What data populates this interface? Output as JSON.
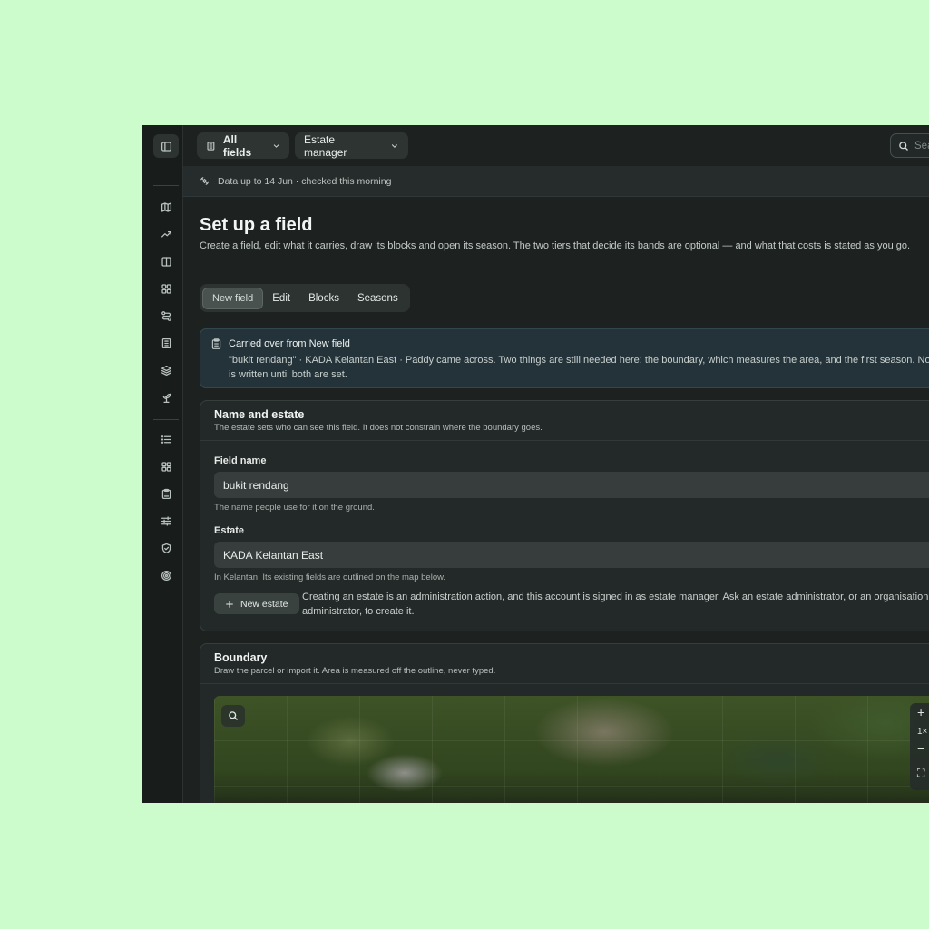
{
  "topbar": {
    "fields_filter": "All fields",
    "role": "Estate manager",
    "search_placeholder": "Search..."
  },
  "status": {
    "text": "Data up to 14 Jun · checked this morning"
  },
  "page": {
    "title": "Set up a field",
    "description": "Create a field, edit what it carries, draw its blocks and open its season. The two tiers that decide its bands are optional — and what that costs is stated as you go."
  },
  "tabs": [
    {
      "label": "New field",
      "active": true
    },
    {
      "label": "Edit",
      "active": false
    },
    {
      "label": "Blocks",
      "active": false
    },
    {
      "label": "Seasons",
      "active": false
    }
  ],
  "notice": {
    "title": "Carried over from New field",
    "body": "\"bukit rendang\" · KADA Kelantan East · Paddy came across. Two things are still needed here: the boundary, which measures the area, and the first season. Nothing is written until both are set."
  },
  "name_card": {
    "title": "Name and estate",
    "subtitle": "The estate sets who can see this field. It does not constrain where the boundary goes.",
    "field_name_label": "Field name",
    "field_name_value": "bukit rendang",
    "field_name_help": "The name people use for it on the ground.",
    "estate_label": "Estate",
    "estate_value": "KADA Kelantan East",
    "estate_help": "In Kelantan. Its existing fields are outlined on the map below.",
    "new_estate_button": "New estate",
    "new_estate_note": "Creating an estate is an administration action, and this account is signed in as estate manager. Ask an estate administrator, or an organisation administrator, to create it."
  },
  "boundary_card": {
    "title": "Boundary",
    "subtitle": "Draw the parcel or import it. Area is measured off the outline, never typed.",
    "zoom_level": "1×"
  }
}
